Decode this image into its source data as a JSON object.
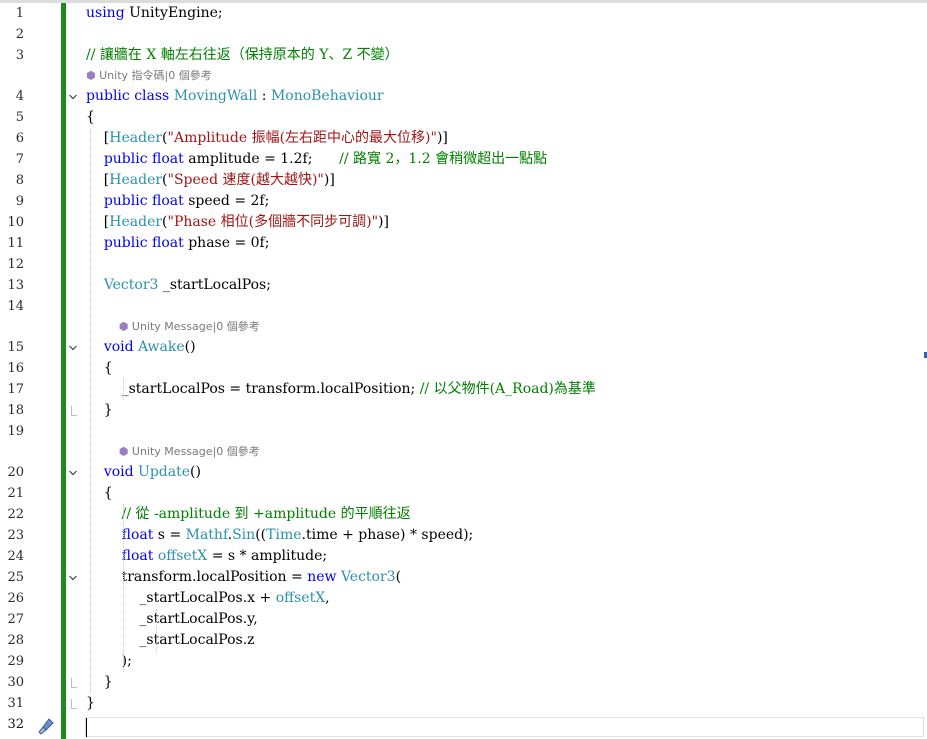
{
  "editor": {
    "lines": [
      {
        "n": "1",
        "segs": [
          {
            "t": "using",
            "c": "kw"
          },
          {
            "t": " UnityEngine;",
            "c": ""
          }
        ]
      },
      {
        "n": "2",
        "segs": []
      },
      {
        "n": "3",
        "segs": [
          {
            "t": "// 讓牆在 X 軸左右往返（保持原本的 Y、Z 不變）",
            "c": "cm"
          }
        ]
      },
      {
        "n": "4",
        "segs": [
          {
            "t": "public",
            "c": "kw"
          },
          {
            "t": " ",
            "c": ""
          },
          {
            "t": "class",
            "c": "kw"
          },
          {
            "t": " ",
            "c": ""
          },
          {
            "t": "MovingWall",
            "c": "ty"
          },
          {
            "t": " : ",
            "c": ""
          },
          {
            "t": "MonoBehaviour",
            "c": "ty"
          }
        ]
      },
      {
        "n": "5",
        "segs": [
          {
            "t": "{",
            "c": ""
          }
        ]
      },
      {
        "n": "6",
        "segs": [
          {
            "t": "    [",
            "c": ""
          },
          {
            "t": "Header",
            "c": "ty"
          },
          {
            "t": "(",
            "c": ""
          },
          {
            "t": "\"Amplitude 振幅(左右距中心的最大位移)\"",
            "c": "str"
          },
          {
            "t": ")]",
            "c": ""
          }
        ]
      },
      {
        "n": "7",
        "segs": [
          {
            "t": "    ",
            "c": ""
          },
          {
            "t": "public",
            "c": "kw"
          },
          {
            "t": " ",
            "c": ""
          },
          {
            "t": "float",
            "c": "kw"
          },
          {
            "t": " amplitude = 1.2f;      ",
            "c": ""
          },
          {
            "t": "// 路寬 2，1.2 會稍微超出一點點",
            "c": "cm"
          }
        ]
      },
      {
        "n": "8",
        "segs": [
          {
            "t": "    [",
            "c": ""
          },
          {
            "t": "Header",
            "c": "ty"
          },
          {
            "t": "(",
            "c": ""
          },
          {
            "t": "\"Speed 速度(越大越快)\"",
            "c": "str"
          },
          {
            "t": ")]",
            "c": ""
          }
        ]
      },
      {
        "n": "9",
        "segs": [
          {
            "t": "    ",
            "c": ""
          },
          {
            "t": "public",
            "c": "kw"
          },
          {
            "t": " ",
            "c": ""
          },
          {
            "t": "float",
            "c": "kw"
          },
          {
            "t": " speed = 2f;",
            "c": ""
          }
        ]
      },
      {
        "n": "10",
        "segs": [
          {
            "t": "    [",
            "c": ""
          },
          {
            "t": "Header",
            "c": "ty"
          },
          {
            "t": "(",
            "c": ""
          },
          {
            "t": "\"Phase 相位(多個牆不同步可調)\"",
            "c": "str"
          },
          {
            "t": ")]",
            "c": ""
          }
        ]
      },
      {
        "n": "11",
        "segs": [
          {
            "t": "    ",
            "c": ""
          },
          {
            "t": "public",
            "c": "kw"
          },
          {
            "t": " ",
            "c": ""
          },
          {
            "t": "float",
            "c": "kw"
          },
          {
            "t": " phase = 0f;",
            "c": ""
          }
        ]
      },
      {
        "n": "12",
        "segs": []
      },
      {
        "n": "13",
        "segs": [
          {
            "t": "    ",
            "c": ""
          },
          {
            "t": "Vector3",
            "c": "ty"
          },
          {
            "t": " _startLocalPos;",
            "c": ""
          }
        ]
      },
      {
        "n": "14",
        "segs": []
      },
      {
        "n": "15",
        "segs": [
          {
            "t": "    ",
            "c": ""
          },
          {
            "t": "void",
            "c": "kw"
          },
          {
            "t": " ",
            "c": ""
          },
          {
            "t": "Awake",
            "c": "ty"
          },
          {
            "t": "()",
            "c": ""
          }
        ]
      },
      {
        "n": "16",
        "segs": [
          {
            "t": "    {",
            "c": ""
          }
        ]
      },
      {
        "n": "17",
        "segs": [
          {
            "t": "        _startLocalPos = transform.localPosition; ",
            "c": ""
          },
          {
            "t": "// 以父物件(A_Road)為基準",
            "c": "cm"
          }
        ]
      },
      {
        "n": "18",
        "segs": [
          {
            "t": "    }",
            "c": ""
          }
        ]
      },
      {
        "n": "19",
        "segs": []
      },
      {
        "n": "20",
        "segs": [
          {
            "t": "    ",
            "c": ""
          },
          {
            "t": "void",
            "c": "kw"
          },
          {
            "t": " ",
            "c": ""
          },
          {
            "t": "Update",
            "c": "ty"
          },
          {
            "t": "()",
            "c": ""
          }
        ]
      },
      {
        "n": "21",
        "segs": [
          {
            "t": "    {",
            "c": ""
          }
        ]
      },
      {
        "n": "22",
        "segs": [
          {
            "t": "        ",
            "c": ""
          },
          {
            "t": "// 從 -amplitude 到 +amplitude 的平順往返",
            "c": "cm"
          }
        ]
      },
      {
        "n": "23",
        "segs": [
          {
            "t": "        ",
            "c": ""
          },
          {
            "t": "float",
            "c": "kw"
          },
          {
            "t": " s = ",
            "c": ""
          },
          {
            "t": "Mathf",
            "c": "ty"
          },
          {
            "t": ".",
            "c": ""
          },
          {
            "t": "Sin",
            "c": "ty"
          },
          {
            "t": "((",
            "c": ""
          },
          {
            "t": "Time",
            "c": "ty"
          },
          {
            "t": ".time + phase) * speed);",
            "c": ""
          }
        ]
      },
      {
        "n": "24",
        "segs": [
          {
            "t": "        ",
            "c": ""
          },
          {
            "t": "float",
            "c": "kw"
          },
          {
            "t": " ",
            "c": ""
          },
          {
            "t": "offsetX",
            "c": "ty"
          },
          {
            "t": " = s * amplitude;",
            "c": ""
          }
        ]
      },
      {
        "n": "25",
        "segs": [
          {
            "t": "        transform.localPosition = ",
            "c": ""
          },
          {
            "t": "new",
            "c": "kw"
          },
          {
            "t": " ",
            "c": ""
          },
          {
            "t": "Vector3",
            "c": "ty"
          },
          {
            "t": "(",
            "c": ""
          }
        ]
      },
      {
        "n": "26",
        "segs": [
          {
            "t": "            _startLocalPos.x + ",
            "c": ""
          },
          {
            "t": "offsetX",
            "c": "ty"
          },
          {
            "t": ",",
            "c": ""
          }
        ]
      },
      {
        "n": "27",
        "segs": [
          {
            "t": "            _startLocalPos.y,",
            "c": ""
          }
        ]
      },
      {
        "n": "28",
        "segs": [
          {
            "t": "            _startLocalPos.z",
            "c": ""
          }
        ]
      },
      {
        "n": "29",
        "segs": [
          {
            "t": "        );",
            "c": ""
          }
        ]
      },
      {
        "n": "30",
        "segs": [
          {
            "t": "    }",
            "c": ""
          }
        ]
      },
      {
        "n": "31",
        "segs": [
          {
            "t": "}",
            "c": ""
          }
        ]
      },
      {
        "n": "32",
        "segs": []
      }
    ],
    "codelens": [
      {
        "after": "3",
        "text": "Unity 指令碼|0 個參考",
        "indent": 0
      },
      {
        "after": "14",
        "text": "Unity Message|0 個參考",
        "indent": 4
      },
      {
        "after": "19",
        "text": "Unity Message|0 個參考",
        "indent": 4
      }
    ],
    "fold_lines": [
      "4",
      "15",
      "20",
      "25"
    ],
    "current_line": "32",
    "icons": {
      "fold": "chevron-down-icon",
      "brush": "paintbrush-icon",
      "lens": "unity-cube-icon"
    }
  }
}
